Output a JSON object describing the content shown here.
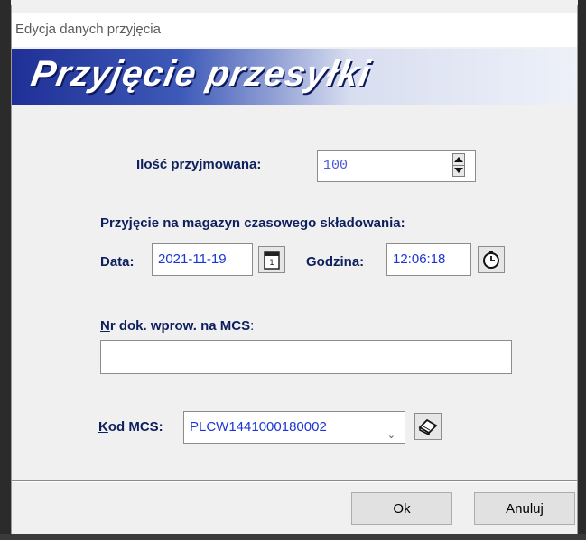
{
  "window": {
    "title": "Edycja danych przyjęcia"
  },
  "banner": {
    "title": "Przyjęcie przesyłki"
  },
  "quantity": {
    "label": "Ilość przyjmowana:",
    "value": "100"
  },
  "storage": {
    "heading": "Przyjęcie na magazyn czasowego składowania:",
    "date_label": "Data:",
    "date_value": "2021-11-19",
    "time_label": "Godzina:",
    "time_value": "12:06:18"
  },
  "doc": {
    "label_first": "N",
    "label_rest": "r dok. wprow. na MCS",
    "label_colon": ":",
    "value": ""
  },
  "mcs": {
    "label_first": "K",
    "label_rest": "od MCS:",
    "selected": "PLCW1441000180002"
  },
  "buttons": {
    "ok": "Ok",
    "cancel": "Anuluj"
  },
  "icons": {
    "spin": "spinner-arrows-icon",
    "calendar": "calendar-icon",
    "clock": "stopwatch-icon",
    "book": "book-icon"
  },
  "colors": {
    "banner_start": "#1f2f96",
    "label": "#0d1f5c",
    "value": "#1b36d3"
  }
}
